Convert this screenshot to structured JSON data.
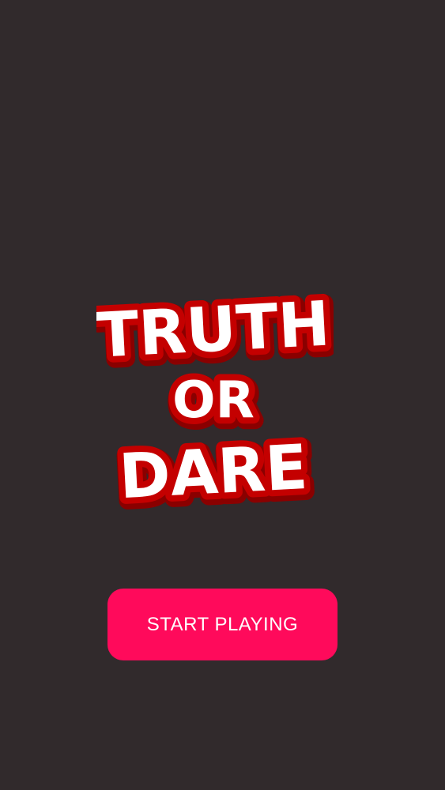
{
  "app": {
    "logo": {
      "line1": "TRUTH",
      "line2": "OR",
      "line3": "DARE"
    },
    "start_button_label": "START PLAYING"
  },
  "colors": {
    "background": "#312a2c",
    "button": "#ff0a5b",
    "button_text": "#ffffff",
    "logo_fill": "#ffffff",
    "logo_outline": "#c40000",
    "logo_shadow": "#8a0000"
  }
}
